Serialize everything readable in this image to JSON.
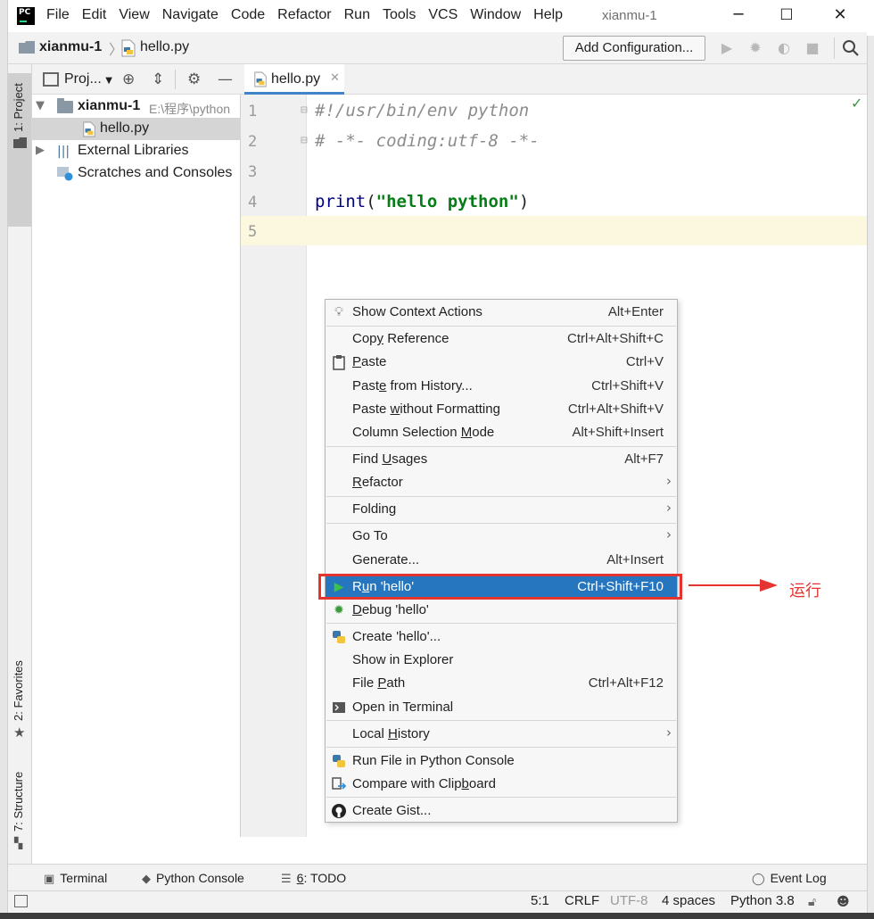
{
  "app": {
    "window_title": "xianmu-1",
    "logo_text": "PC",
    "menu": [
      "File",
      "Edit",
      "View",
      "Navigate",
      "Code",
      "Refactor",
      "Run",
      "Tools",
      "VCS",
      "Window",
      "Help"
    ],
    "win_min": "─",
    "win_max": "☐",
    "win_close": "✕"
  },
  "navbar": {
    "project": "xianmu-1",
    "separator": "〉",
    "file": "hello.py",
    "add_config": "Add Configuration..."
  },
  "side_tabs": {
    "project": "1: Project",
    "favorites": "2: Favorites",
    "structure": "7: Structure"
  },
  "project_panel": {
    "title": "Proj...",
    "tree": [
      {
        "label": "xianmu-1",
        "path": "E:\\程序\\python"
      },
      {
        "label": "hello.py"
      },
      {
        "label": "External Libraries"
      },
      {
        "label": "Scratches and Consoles"
      }
    ]
  },
  "editor": {
    "tab": "hello.py",
    "line_numbers": [
      "1",
      "2",
      "3",
      "4",
      "5"
    ],
    "lines": {
      "l1": "#!/usr/bin/env python",
      "l2": "# -*- coding:utf-8 -*-",
      "l4_fn": "print",
      "l4_open": "(",
      "l4_str": "\"hello python\"",
      "l4_close": ")"
    }
  },
  "context_menu": {
    "show_context_actions": {
      "label": "Show Context Actions",
      "shortcut": "Alt+Enter"
    },
    "copy_reference": {
      "pre": "Cop",
      "mn": "y",
      "post": " Reference",
      "shortcut": "Ctrl+Alt+Shift+C"
    },
    "paste": {
      "pre": "",
      "mn": "P",
      "post": "aste",
      "shortcut": "Ctrl+V"
    },
    "paste_from_history": {
      "pre": "Past",
      "mn": "e",
      "post": " from History...",
      "shortcut": "Ctrl+Shift+V"
    },
    "paste_without_formatting": {
      "pre": "Paste ",
      "mn": "w",
      "post": "ithout Formatting",
      "shortcut": "Ctrl+Alt+Shift+V"
    },
    "column_selection_mode": {
      "pre": "Column Selection ",
      "mn": "M",
      "post": "ode",
      "shortcut": "Alt+Shift+Insert"
    },
    "find_usages": {
      "pre": "Find ",
      "mn": "U",
      "post": "sages",
      "shortcut": "Alt+F7"
    },
    "refactor": {
      "pre": "",
      "mn": "R",
      "post": "efactor"
    },
    "folding": {
      "label": "Folding"
    },
    "go_to": {
      "label": "Go To"
    },
    "generate": {
      "label": "Generate...",
      "shortcut": "Alt+Insert"
    },
    "run_hello": {
      "pre": "R",
      "mn": "u",
      "post": "n 'hello'",
      "shortcut": "Ctrl+Shift+F10"
    },
    "debug_hello": {
      "pre": "",
      "mn": "D",
      "post": "ebug 'hello'"
    },
    "create_hello": {
      "label": "Create 'hello'..."
    },
    "show_in_explorer": {
      "label": "Show in Explorer"
    },
    "file_path": {
      "pre": "File ",
      "mn": "P",
      "post": "ath",
      "shortcut": "Ctrl+Alt+F12"
    },
    "open_in_terminal": {
      "label": "Open in Terminal"
    },
    "local_history": {
      "pre": "Local ",
      "mn": "H",
      "post": "istory"
    },
    "run_file_in_console": {
      "label": "Run File in Python Console"
    },
    "compare_with_clipboard": {
      "pre": "Compare with Clip",
      "mn": "b",
      "post": "oard"
    },
    "create_gist": {
      "label": "Create Gist..."
    }
  },
  "annotation": {
    "label": "运行",
    "color": "#e3342f"
  },
  "bottom_toolbar": {
    "terminal": "Terminal",
    "python_console": "Python Console",
    "todo_num": "6",
    "todo_label": ": TODO",
    "event_log": "Event Log"
  },
  "status_bar": {
    "position": "5:1",
    "line_sep": "CRLF",
    "encoding": "UTF-8",
    "indent": "4 spaces",
    "interpreter": "Python 3.8"
  },
  "colors": {
    "selection": "#2675bf",
    "highlight_box": "#e3342f",
    "current_line": "#fcf7df",
    "string": "#067d17",
    "keyword": "#000080"
  }
}
